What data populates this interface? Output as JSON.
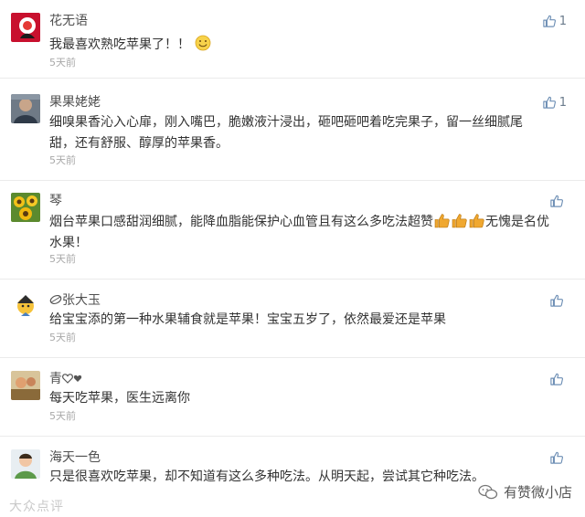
{
  "comments": [
    {
      "username": "花无语",
      "text": "我最喜欢熟吃苹果了！！",
      "time": "5天前",
      "likes": "1",
      "avatar_icon": "red-flower-avatar"
    },
    {
      "username": "果果姥姥",
      "text": "细嗅果香沁入心扉，刚入嘴巴，脆嫩液汁浸出，砸吧砸吧着吃完果子，留一丝细腻尾甜，还有舒服、醇厚的苹果香。",
      "time": "5天前",
      "likes": "1",
      "avatar_icon": "person-avatar"
    },
    {
      "username": "琴",
      "text_before": "烟台苹果口感甜润细腻，能降血脂能保护心血管且有这么多吃法超赞",
      "text_after": "无愧是名优水果！",
      "time": "5天前",
      "likes": "",
      "avatar_icon": "sunflower-avatar"
    },
    {
      "username": "张大玉",
      "text": "给宝宝添的第一种水果辅食就是苹果！宝宝五岁了，依然最爱还是苹果",
      "time": "5天前",
      "likes": "",
      "avatar_icon": "cartoon-avatar"
    },
    {
      "username": "青",
      "text": "每天吃苹果，医生远离你",
      "time": "5天前",
      "likes": "",
      "avatar_icon": "photo-avatar"
    },
    {
      "username": "海天一色",
      "text": "只是很喜欢吃苹果，却不知道有这么多种吃法。从明天起，尝试其它种吃法。",
      "time": "",
      "likes": "",
      "avatar_icon": "child-avatar"
    }
  ],
  "watermark_left": "大众点评",
  "watermark_right": "有赞微小店",
  "colors": {
    "like_icon": "#6e8fb5",
    "thumb_emoji": "#f0a830",
    "time_text": "#a8a8a8"
  }
}
